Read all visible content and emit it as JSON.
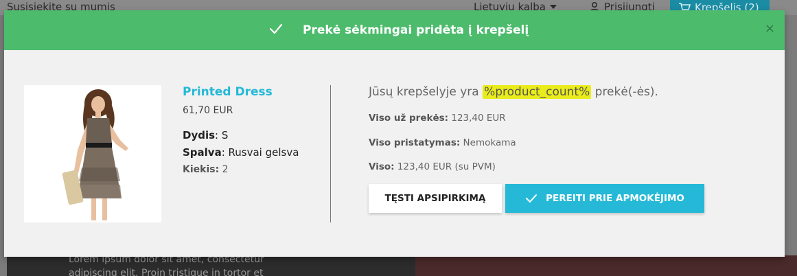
{
  "background": {
    "contact_link": "Susisiekite su mumis",
    "language": "Lietuvių kalba",
    "sign_in": "Prisijungti",
    "cart": "Krepšelis (2)",
    "lorem": "Lorem ipsum dolor sit amet, consectetur adipiscing elit. Proin tristique in tortor et"
  },
  "modal": {
    "header_title": "Prekė sėkmingai pridėta į krepšelį",
    "close_symbol": "×",
    "product": {
      "name": "Printed Dress",
      "price": "61,70 EUR",
      "size_label": "Dydis",
      "size_value": ": S",
      "color_label": "Spalva",
      "color_value": ": Rusvai gelsva",
      "qty_label": "Kiekis:",
      "qty_value": " 2"
    },
    "cart_count_prefix": "Jūsų krepšelyje yra ",
    "cart_count_placeholder": "%product_count%",
    "cart_count_suffix": " prekė(-ės).",
    "subtotal_label": "Viso už prekės:",
    "subtotal_value": " 123,40 EUR",
    "shipping_label": "Viso pristatymas:",
    "shipping_value": " Nemokama",
    "total_label": "Viso:",
    "total_value": " 123,40 EUR (su PVM)",
    "continue_button": "TĘSTI APSIPIRKIMĄ",
    "checkout_button": "PEREITI PRIE APMOKĖJIMO"
  },
  "colors": {
    "success_header": "#4cbb6c",
    "accent": "#25b9d7",
    "highlight": "#e9ec1a"
  }
}
